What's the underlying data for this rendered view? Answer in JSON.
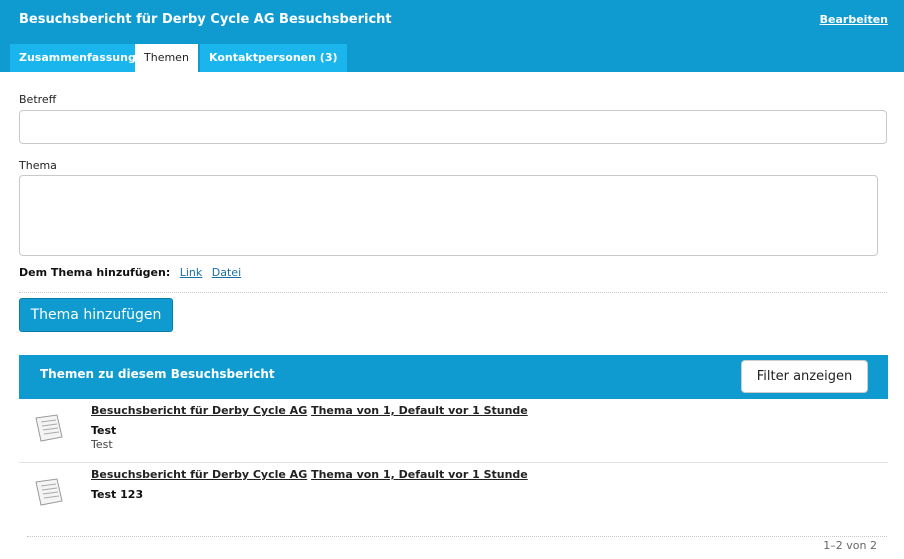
{
  "header": {
    "title": "Besuchsbericht für Derby Cycle AG Besuchsbericht",
    "edit_label": "Bearbeiten"
  },
  "tabs": [
    {
      "label": "Zusammenfassung",
      "active": false
    },
    {
      "label": "Themen",
      "active": true
    },
    {
      "label": "Kontaktpersonen (3)",
      "active": false
    }
  ],
  "form": {
    "subject_label": "Betreff",
    "subject_value": "",
    "topic_label": "Thema",
    "topic_value": "",
    "add_to_label": "Dem Thema hinzufügen:",
    "link_label": "Link",
    "file_label": "Datei",
    "submit_label": "Thema hinzufügen"
  },
  "list": {
    "title": "Themen zu diesem Besuchsbericht",
    "filter_label": "Filter anzeigen",
    "items": [
      {
        "report_link": "Besuchsbericht für Derby Cycle AG",
        "meta_link": "Thema von 1, Default vor 1 Stunde",
        "title": "Test",
        "body": "Test"
      },
      {
        "report_link": "Besuchsbericht für Derby Cycle AG",
        "meta_link": "Thema von 1, Default vor 1 Stunde",
        "title": "Test 123",
        "body": ""
      }
    ],
    "pagination": "1–2 von 2"
  },
  "colors": {
    "header_blue": "#0f9bd0",
    "tab_blue": "#19b5ec"
  },
  "icons": [
    "document-icon"
  ]
}
